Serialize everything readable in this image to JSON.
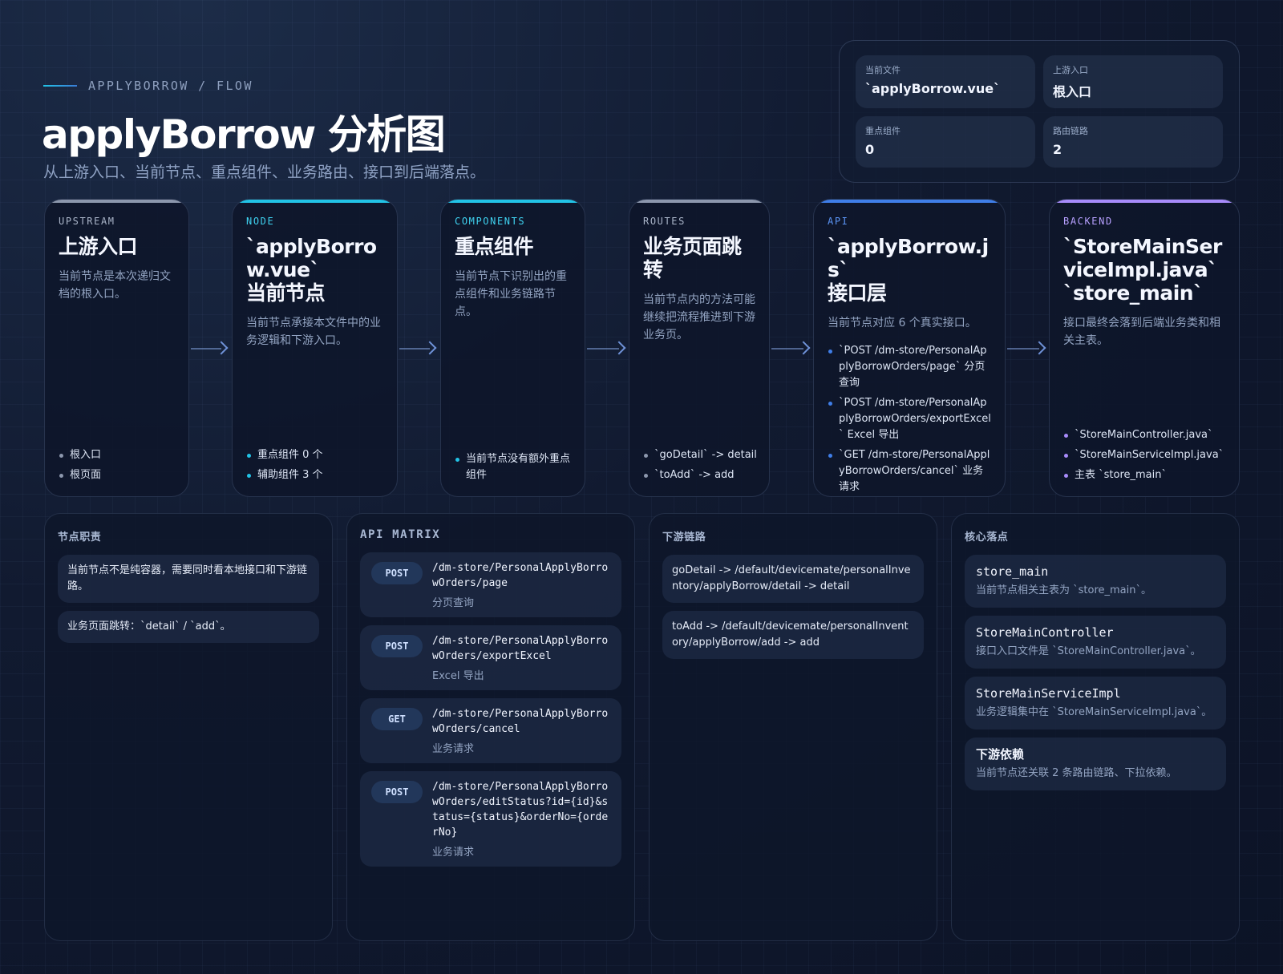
{
  "header": {
    "eyebrow": "APPLYBORROW / FLOW",
    "title": "applyBorrow 分析图",
    "subtitle": "从上游入口、当前节点、重点组件、业务路由、接口到后端落点。"
  },
  "stats": [
    {
      "label": "当前文件",
      "value": "`applyBorrow.vue`"
    },
    {
      "label": "上游入口",
      "value": "根入口"
    },
    {
      "label": "重点组件",
      "value": "0"
    },
    {
      "label": "路由链路",
      "value": "2"
    }
  ],
  "flow": {
    "upstream": {
      "tag": "UPSTREAM",
      "title": "上游入口",
      "desc": "当前节点是本次递归文档的根入口。",
      "items": [
        "根入口",
        "根页面"
      ]
    },
    "node": {
      "tag": "NODE",
      "title_line1": "`applyBorrow.vue`",
      "title_line2": "当前节点",
      "desc": "当前节点承接本文件中的业务逻辑和下游入口。",
      "items": [
        "重点组件 0 个",
        "辅助组件 3 个"
      ]
    },
    "components": {
      "tag": "COMPONENTS",
      "title": "重点组件",
      "desc": "当前节点下识别出的重点组件和业务链路节点。",
      "items": [
        "当前节点没有额外重点组件"
      ]
    },
    "routes": {
      "tag": "ROUTES",
      "title": "业务页面跳转",
      "desc": "当前节点内的方法可能继续把流程推进到下游业务页。",
      "items": [
        "`goDetail` -> detail",
        "`toAdd` -> add"
      ]
    },
    "api": {
      "tag": "API",
      "title_line1": "`applyBorrow.js`",
      "title_line2": "接口层",
      "desc": "当前节点对应 6 个真实接口。",
      "items": [
        "`POST /dm-store/PersonalApplyBorrowOrders/page` 分页查询",
        "`POST /dm-store/PersonalApplyBorrowOrders/exportExcel` Excel 导出",
        "`GET /dm-store/PersonalApplyBorrowOrders/cancel` 业务请求"
      ]
    },
    "backend": {
      "tag": "BACKEND",
      "title_line1": "`StoreMainServiceImpl.java`",
      "title_line2": "`store_main`",
      "desc": "接口最终会落到后端业务类和相关主表。",
      "items": [
        "`StoreMainController.java`",
        "`StoreMainServiceImpl.java`",
        "主表 `store_main`"
      ]
    }
  },
  "duties": {
    "heading": "节点职责",
    "items": [
      "当前节点不是纯容器，需要同时看本地接口和下游链路。",
      "业务页面跳转：`detail` / `add`。"
    ]
  },
  "api_matrix": {
    "heading": "API MATRIX",
    "items": [
      {
        "method": "POST",
        "path": "/dm-store/PersonalApplyBorrowOrders/page",
        "note": "分页查询"
      },
      {
        "method": "POST",
        "path": "/dm-store/PersonalApplyBorrowOrders/exportExcel",
        "note": "Excel 导出"
      },
      {
        "method": "GET",
        "path": "/dm-store/PersonalApplyBorrowOrders/cancel",
        "note": "业务请求"
      },
      {
        "method": "POST",
        "path": "/dm-store/PersonalApplyBorrowOrders/editStatus?id={id}&status={status}&orderNo={orderNo}",
        "note": "业务请求"
      }
    ]
  },
  "downstream": {
    "heading": "下游链路",
    "items": [
      "goDetail -> /default/devicemate/personalInventory/applyBorrow/detail -> detail",
      "toAdd -> /default/devicemate/personalInventory/applyBorrow/add -> add"
    ]
  },
  "core": {
    "heading": "核心落点",
    "items": [
      {
        "title": "store_main",
        "desc": "当前节点相关主表为 `store_main`。"
      },
      {
        "title": "StoreMainController",
        "desc": "接口入口文件是 `StoreMainController.java`。"
      },
      {
        "title": "StoreMainServiceImpl",
        "desc": "业务逻辑集中在 `StoreMainServiceImpl.java`。"
      },
      {
        "title": "下游依赖",
        "desc": "当前节点还关联 2 条路由链路、下拉依赖。"
      }
    ]
  },
  "colors": {
    "upstream": "#8c97ad",
    "node": "#22c3e6",
    "components": "#22c3e6",
    "routes": "#8c97ad",
    "api": "#3f7ee8",
    "backend": "#a78bfa"
  }
}
